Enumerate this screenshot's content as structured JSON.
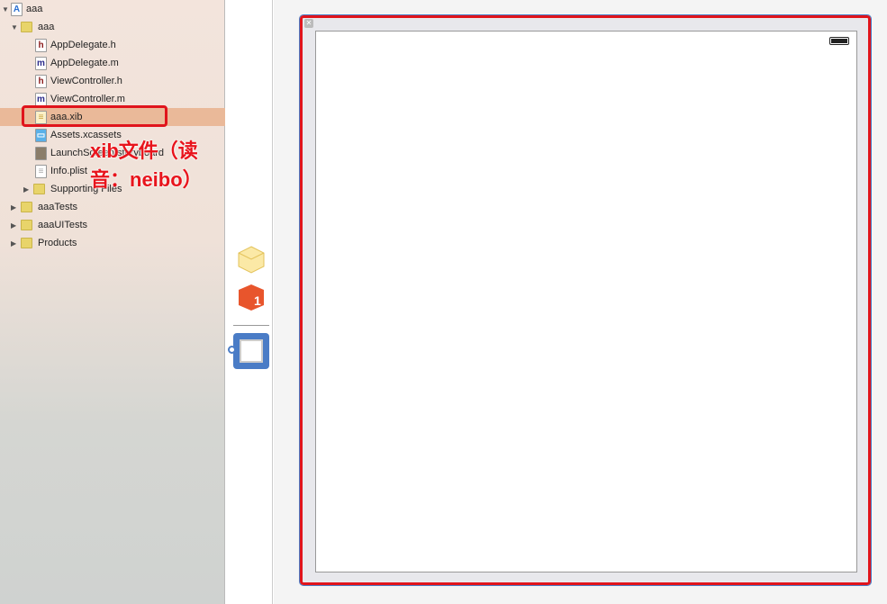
{
  "navigator": {
    "items": [
      {
        "label": "aaa",
        "icon": "project-icon",
        "indent": 0,
        "disclosure": "open"
      },
      {
        "label": "aaa",
        "icon": "folder-icon",
        "indent": 1,
        "disclosure": "open"
      },
      {
        "label": "AppDelegate.h",
        "icon": "header-file-icon",
        "indent": 2
      },
      {
        "label": "AppDelegate.m",
        "icon": "objc-file-icon",
        "indent": 2
      },
      {
        "label": "ViewController.h",
        "icon": "header-file-icon",
        "indent": 2
      },
      {
        "label": "ViewController.m",
        "icon": "objc-file-icon",
        "indent": 2
      },
      {
        "label": "aaa.xib",
        "icon": "xib-file-icon",
        "indent": 2,
        "selected": true
      },
      {
        "label": "Assets.xcassets",
        "icon": "assets-icon",
        "indent": 2
      },
      {
        "label": "LaunchScreen.storyboard",
        "icon": "storyboard-icon",
        "indent": 2
      },
      {
        "label": "Info.plist",
        "icon": "plist-icon",
        "indent": 2
      },
      {
        "label": "Supporting Files",
        "icon": "folder-icon",
        "indent": 2,
        "disclosure": "closed"
      },
      {
        "label": "aaaTests",
        "icon": "folder-icon",
        "indent": 1,
        "disclosure": "closed"
      },
      {
        "label": "aaaUITests",
        "icon": "folder-icon",
        "indent": 1,
        "disclosure": "closed"
      },
      {
        "label": "Products",
        "icon": "folder-icon",
        "indent": 1,
        "disclosure": "closed"
      }
    ]
  },
  "annotation": {
    "text": "xib文件（读音：neibo）",
    "color": "#e0141c"
  },
  "colors": {
    "selection": "#eab999",
    "highlight": "#e0141c",
    "viewBorder": "#4a7cc6"
  }
}
